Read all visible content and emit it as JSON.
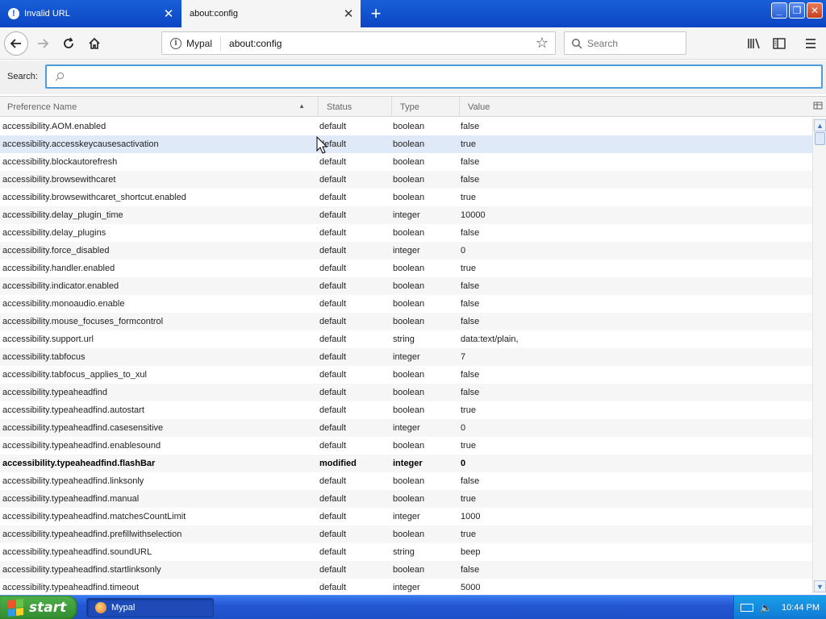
{
  "tabs": [
    {
      "title": "Invalid URL",
      "active": false
    },
    {
      "title": "about:config",
      "active": true
    }
  ],
  "navbar": {
    "identity_label": "Mypal",
    "url": "about:config",
    "search_placeholder": "Search"
  },
  "config_search": {
    "label": "Search:",
    "value": ""
  },
  "table": {
    "columns": [
      "Preference Name",
      "Status",
      "Type",
      "Value"
    ],
    "sort_column": "Preference Name",
    "rows": [
      {
        "name": "accessibility.AOM.enabled",
        "status": "default",
        "type": "boolean",
        "value": "false"
      },
      {
        "name": "accessibility.accesskeycausesactivation",
        "status": "default",
        "type": "boolean",
        "value": "true"
      },
      {
        "name": "accessibility.blockautorefresh",
        "status": "default",
        "type": "boolean",
        "value": "false"
      },
      {
        "name": "accessibility.browsewithcaret",
        "status": "default",
        "type": "boolean",
        "value": "false"
      },
      {
        "name": "accessibility.browsewithcaret_shortcut.enabled",
        "status": "default",
        "type": "boolean",
        "value": "true"
      },
      {
        "name": "accessibility.delay_plugin_time",
        "status": "default",
        "type": "integer",
        "value": "10000"
      },
      {
        "name": "accessibility.delay_plugins",
        "status": "default",
        "type": "boolean",
        "value": "false"
      },
      {
        "name": "accessibility.force_disabled",
        "status": "default",
        "type": "integer",
        "value": "0"
      },
      {
        "name": "accessibility.handler.enabled",
        "status": "default",
        "type": "boolean",
        "value": "true"
      },
      {
        "name": "accessibility.indicator.enabled",
        "status": "default",
        "type": "boolean",
        "value": "false"
      },
      {
        "name": "accessibility.monoaudio.enable",
        "status": "default",
        "type": "boolean",
        "value": "false"
      },
      {
        "name": "accessibility.mouse_focuses_formcontrol",
        "status": "default",
        "type": "boolean",
        "value": "false"
      },
      {
        "name": "accessibility.support.url",
        "status": "default",
        "type": "string",
        "value": "data:text/plain,"
      },
      {
        "name": "accessibility.tabfocus",
        "status": "default",
        "type": "integer",
        "value": "7"
      },
      {
        "name": "accessibility.tabfocus_applies_to_xul",
        "status": "default",
        "type": "boolean",
        "value": "false"
      },
      {
        "name": "accessibility.typeaheadfind",
        "status": "default",
        "type": "boolean",
        "value": "false"
      },
      {
        "name": "accessibility.typeaheadfind.autostart",
        "status": "default",
        "type": "boolean",
        "value": "true"
      },
      {
        "name": "accessibility.typeaheadfind.casesensitive",
        "status": "default",
        "type": "integer",
        "value": "0"
      },
      {
        "name": "accessibility.typeaheadfind.enablesound",
        "status": "default",
        "type": "boolean",
        "value": "true"
      },
      {
        "name": "accessibility.typeaheadfind.flashBar",
        "status": "modified",
        "type": "integer",
        "value": "0"
      },
      {
        "name": "accessibility.typeaheadfind.linksonly",
        "status": "default",
        "type": "boolean",
        "value": "false"
      },
      {
        "name": "accessibility.typeaheadfind.manual",
        "status": "default",
        "type": "boolean",
        "value": "true"
      },
      {
        "name": "accessibility.typeaheadfind.matchesCountLimit",
        "status": "default",
        "type": "integer",
        "value": "1000"
      },
      {
        "name": "accessibility.typeaheadfind.prefillwithselection",
        "status": "default",
        "type": "boolean",
        "value": "true"
      },
      {
        "name": "accessibility.typeaheadfind.soundURL",
        "status": "default",
        "type": "string",
        "value": "beep"
      },
      {
        "name": "accessibility.typeaheadfind.startlinksonly",
        "status": "default",
        "type": "boolean",
        "value": "false"
      },
      {
        "name": "accessibility.typeaheadfind.timeout",
        "status": "default",
        "type": "integer",
        "value": "5000"
      }
    ]
  },
  "taskbar": {
    "start_label": "start",
    "task_label": "Mypal",
    "clock": "10:44 PM"
  }
}
